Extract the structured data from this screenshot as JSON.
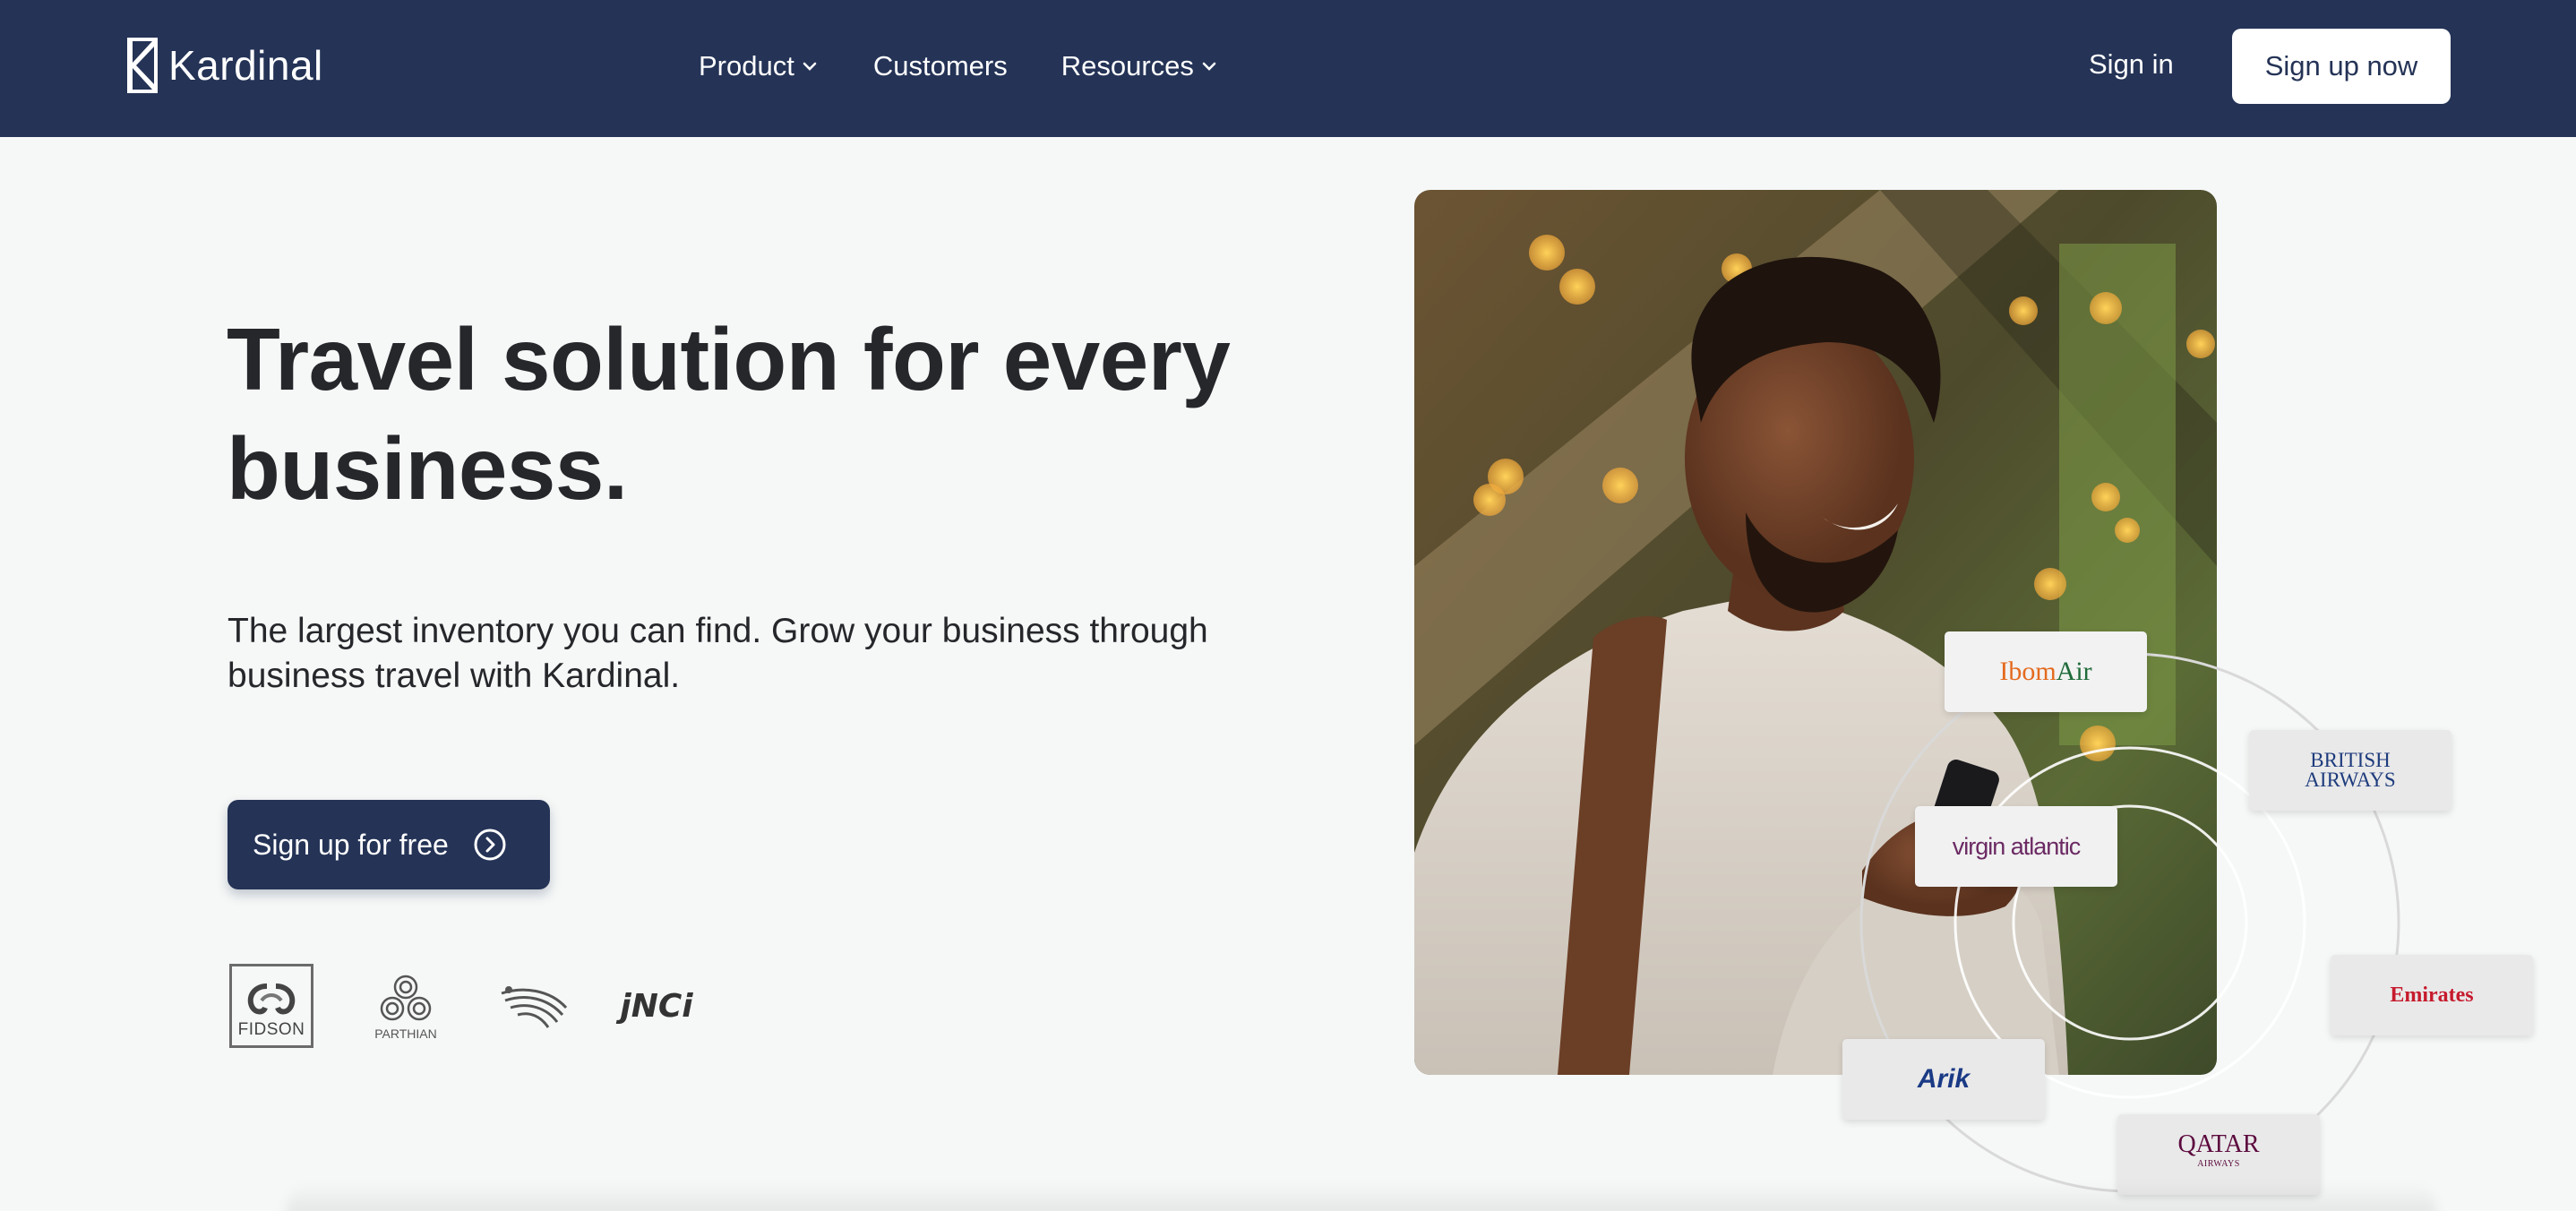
{
  "nav": {
    "brand": "Kardinal",
    "links": [
      {
        "label": "Product",
        "has_dropdown": true
      },
      {
        "label": "Customers",
        "has_dropdown": false
      },
      {
        "label": "Resources",
        "has_dropdown": true
      }
    ],
    "sign_in": "Sign in",
    "sign_up": "Sign up now"
  },
  "hero": {
    "headline": "Travel solution for every business.",
    "subtext": "The largest inventory you can find. Grow your business through business travel with Kardinal.",
    "cta_label": "Sign up for free",
    "cta_icon": "circle-chevron-right-icon"
  },
  "clients": [
    {
      "name": "fidson",
      "label": "FIDSON"
    },
    {
      "name": "parthian",
      "label": "PARTHIAN"
    },
    {
      "name": "eagle",
      "label": ""
    },
    {
      "name": "jnci",
      "label": "jNCi"
    }
  ],
  "airlines": {
    "ibom": {
      "part1": "Ibom",
      "part2": "Air"
    },
    "virgin": "virgin atlantic",
    "british": {
      "line1": "BRITISH",
      "line2": "AIRWAYS"
    },
    "emirates": "Emirates",
    "arik": "Arik",
    "qatar": {
      "name": "QATAR",
      "sub": "AIRWAYS"
    }
  },
  "colors": {
    "navy": "#243356",
    "background": "#f6f8f7",
    "text": "#26272b"
  }
}
